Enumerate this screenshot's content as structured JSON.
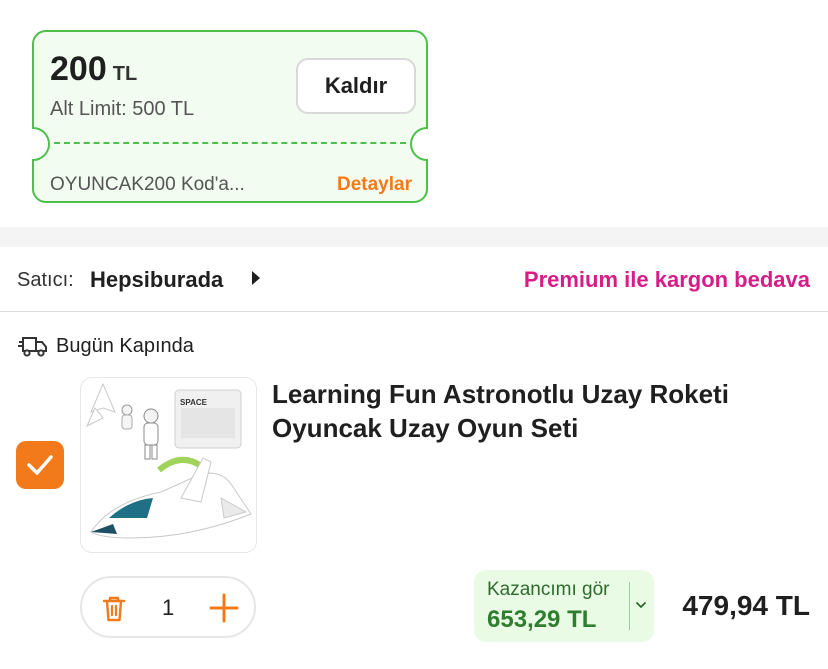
{
  "coupon": {
    "amount": "200",
    "currency": "TL",
    "limit": "Alt Limit: 500 TL",
    "remove_label": "Kaldır",
    "code_text": "OYUNCAK200 Kod'a...",
    "details_label": "Detaylar",
    "accent_color": "#4cc04b"
  },
  "seller": {
    "label": "Satıcı:",
    "name": "Hepsiburada",
    "premium_text": "Premium ile kargon bedava",
    "premium_color": "#d61d87"
  },
  "delivery": {
    "icon": "delivery-truck-icon",
    "text": "Bugün Kapında"
  },
  "product": {
    "checked": true,
    "title": "Learning Fun Astronotlu Uzay Roketi Oyuncak Uzay Oyun Seti",
    "quantity": "1",
    "earn_label": "Kazancımı gör",
    "earn_amount": "653,29 TL",
    "price": "479,94 TL",
    "box_brand_text": "SPACE"
  },
  "colors": {
    "orange": "#f27a1a",
    "green": "#2f7e2f"
  }
}
